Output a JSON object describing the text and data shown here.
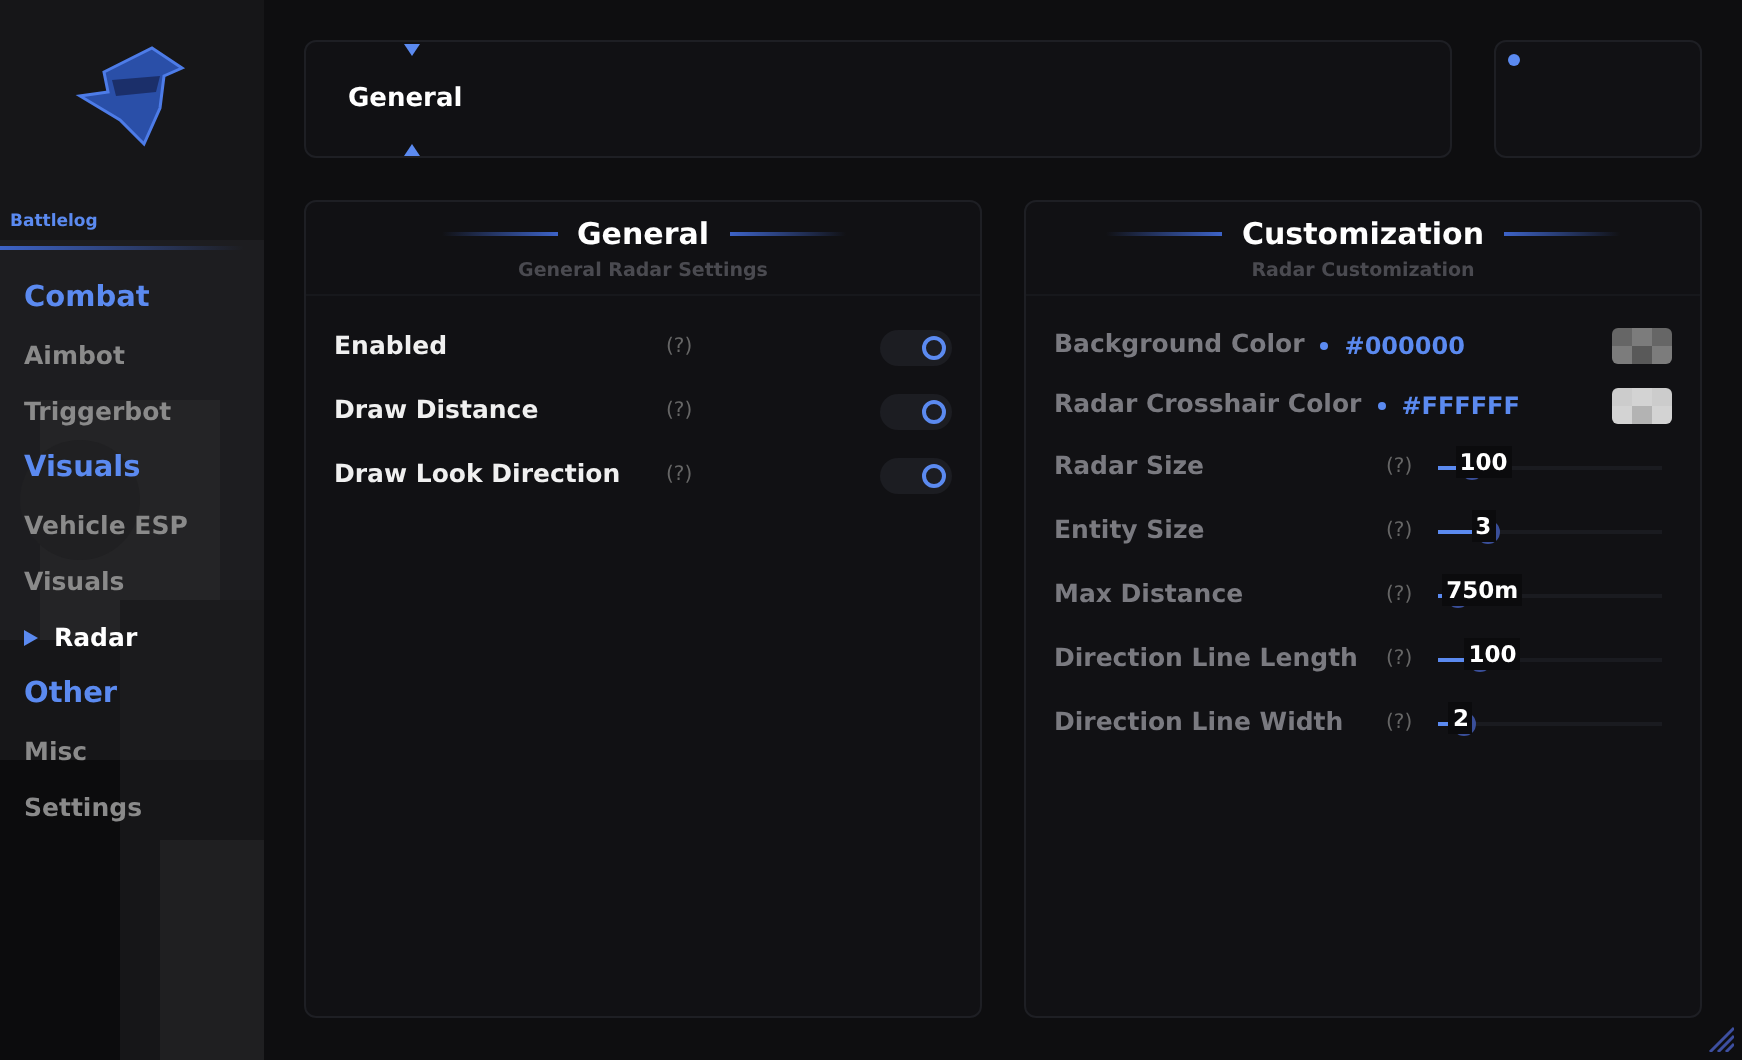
{
  "sidebar": {
    "brand": "Battlelog",
    "items": [
      {
        "kind": "header",
        "label": "Combat"
      },
      {
        "kind": "item",
        "label": "Aimbot",
        "selected": false
      },
      {
        "kind": "item",
        "label": "Triggerbot",
        "selected": false
      },
      {
        "kind": "header",
        "label": "Visuals"
      },
      {
        "kind": "item",
        "label": "Vehicle ESP",
        "selected": false
      },
      {
        "kind": "item",
        "label": "Visuals",
        "selected": false
      },
      {
        "kind": "item",
        "label": "Radar",
        "selected": true
      },
      {
        "kind": "header",
        "label": "Other"
      },
      {
        "kind": "item",
        "label": "Misc",
        "selected": false
      },
      {
        "kind": "item",
        "label": "Settings",
        "selected": false
      }
    ]
  },
  "tab_selector": {
    "label": "General"
  },
  "panels": [
    {
      "title": "General",
      "subtitle": "General Radar Settings",
      "rows": [
        {
          "kind": "toggle",
          "label": "Enabled",
          "help": "(?)",
          "on": true
        },
        {
          "kind": "toggle",
          "label": "Draw Distance",
          "help": "(?)",
          "on": true
        },
        {
          "kind": "toggle",
          "label": "Draw Look Direction",
          "help": "(?)",
          "on": true
        }
      ]
    },
    {
      "title": "Customization",
      "subtitle": "Radar Customization",
      "rows": [
        {
          "kind": "color",
          "label": "Background Color",
          "value": "#000000",
          "color": "#666666"
        },
        {
          "kind": "color",
          "label": "Radar Crosshair Color",
          "value": "#FFFFFF",
          "color": "#cccccc"
        },
        {
          "kind": "slider",
          "label": "Radar Size",
          "help": "(?)",
          "value": "100",
          "level": 0.15
        },
        {
          "kind": "slider",
          "label": "Entity Size",
          "help": "(?)",
          "value": "3",
          "level": 0.22
        },
        {
          "kind": "slider",
          "label": "Max Distance",
          "help": "(?)",
          "value": "750m",
          "level": 0.09
        },
        {
          "kind": "slider",
          "label": "Direction Line Length",
          "help": "(?)",
          "value": "100",
          "level": 0.19
        },
        {
          "kind": "slider",
          "label": "Direction Line Width",
          "help": "(?)",
          "value": "2",
          "level": 0.12
        }
      ]
    }
  ]
}
